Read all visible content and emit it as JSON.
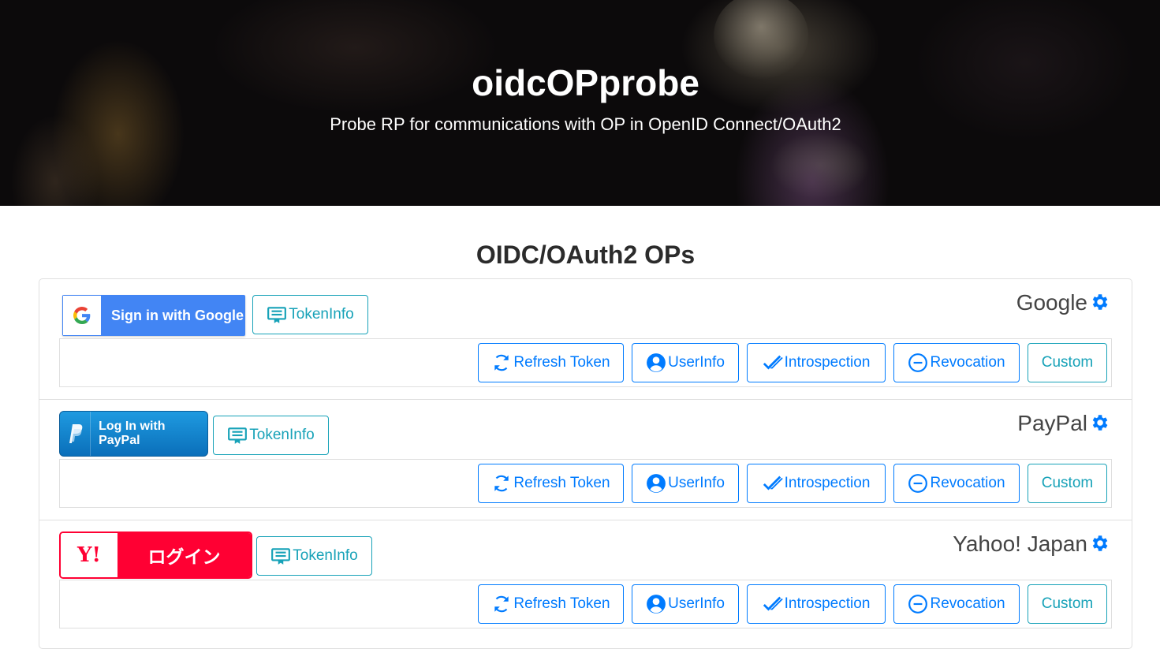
{
  "header": {
    "title": "oidcOPprobe",
    "subtitle": "Probe RP for communications with OP in OpenID Connect/OAuth2"
  },
  "section": {
    "title": "OIDC/OAuth2 OPs"
  },
  "providers": [
    {
      "name": "Google",
      "signin_label": "Sign in with Google",
      "tokeninfo_label": "TokenInfo",
      "actions": {
        "refresh": "Refresh Token",
        "userinfo": "UserInfo",
        "introspection": "Introspection",
        "revocation": "Revocation",
        "custom": "Custom"
      }
    },
    {
      "name": "PayPal",
      "signin_label": "Log In with PayPal",
      "tokeninfo_label": "TokenInfo",
      "actions": {
        "refresh": "Refresh Token",
        "userinfo": "UserInfo",
        "introspection": "Introspection",
        "revocation": "Revocation",
        "custom": "Custom"
      }
    },
    {
      "name": "Yahoo! Japan",
      "signin_logo": "Y!",
      "signin_label": "ログイン",
      "tokeninfo_label": "TokenInfo",
      "actions": {
        "refresh": "Refresh Token",
        "userinfo": "UserInfo",
        "introspection": "Introspection",
        "revocation": "Revocation",
        "custom": "Custom"
      }
    }
  ],
  "colors": {
    "primary": "#007bff",
    "info": "#17a2b8",
    "google": "#4285f4",
    "paypal": "#0a6fba",
    "yahoo": "#ff0033"
  },
  "icons": {
    "settings": "gear-icon",
    "tokeninfo": "certificate-icon",
    "refresh": "sync-icon",
    "userinfo": "user-circle-icon",
    "introspection": "double-check-icon",
    "revocation": "minus-circle-icon"
  }
}
